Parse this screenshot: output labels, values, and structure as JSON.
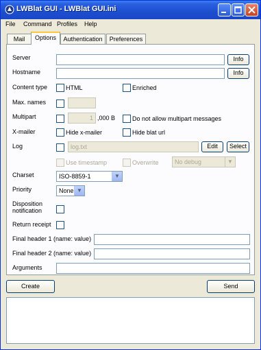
{
  "window": {
    "title": "LWBlat GUI - LWBlat GUI.ini"
  },
  "menu": {
    "items": [
      "File",
      "Command",
      "Profiles",
      "Help"
    ]
  },
  "tabs": [
    "Mail",
    "Options",
    "Authentication",
    "Preferences"
  ],
  "options": {
    "server": {
      "label": "Server",
      "value": "",
      "button": "Info"
    },
    "hostname": {
      "label": "Hostname",
      "value": "",
      "button": "Info"
    },
    "content_type": {
      "label": "Content type",
      "html": "HTML",
      "enriched": "Enriched"
    },
    "max_names": {
      "label": "Max. names",
      "value": ""
    },
    "multipart": {
      "label": "Multipart",
      "value": "1",
      "unit": ",000 B",
      "no_multipart": "Do not allow multipart messages"
    },
    "xmailer": {
      "label": "X-mailer",
      "hide_xmailer": "Hide x-mailer",
      "hide_blat_url": "Hide blat url"
    },
    "log": {
      "label": "Log",
      "value": "log.txt",
      "edit": "Edit",
      "select": "Select",
      "use_timestamp": "Use timestamp",
      "overwrite": "Overwrite",
      "debug": "No debug"
    },
    "charset": {
      "label": "Charset",
      "value": "ISO-8859-1"
    },
    "priority": {
      "label": "Priority",
      "value": "None"
    },
    "disposition": {
      "label_line1": "Disposition",
      "label_line2": "notification"
    },
    "return_receipt": {
      "label": "Return receipt"
    },
    "final_header_1": {
      "label": "Final header 1 (name: value)",
      "value": ""
    },
    "final_header_2": {
      "label": "Final header 2 (name: value)",
      "value": ""
    },
    "arguments": {
      "label": "Arguments",
      "value": ""
    }
  },
  "actions": {
    "create": "Create",
    "send": "Send"
  },
  "output": ""
}
